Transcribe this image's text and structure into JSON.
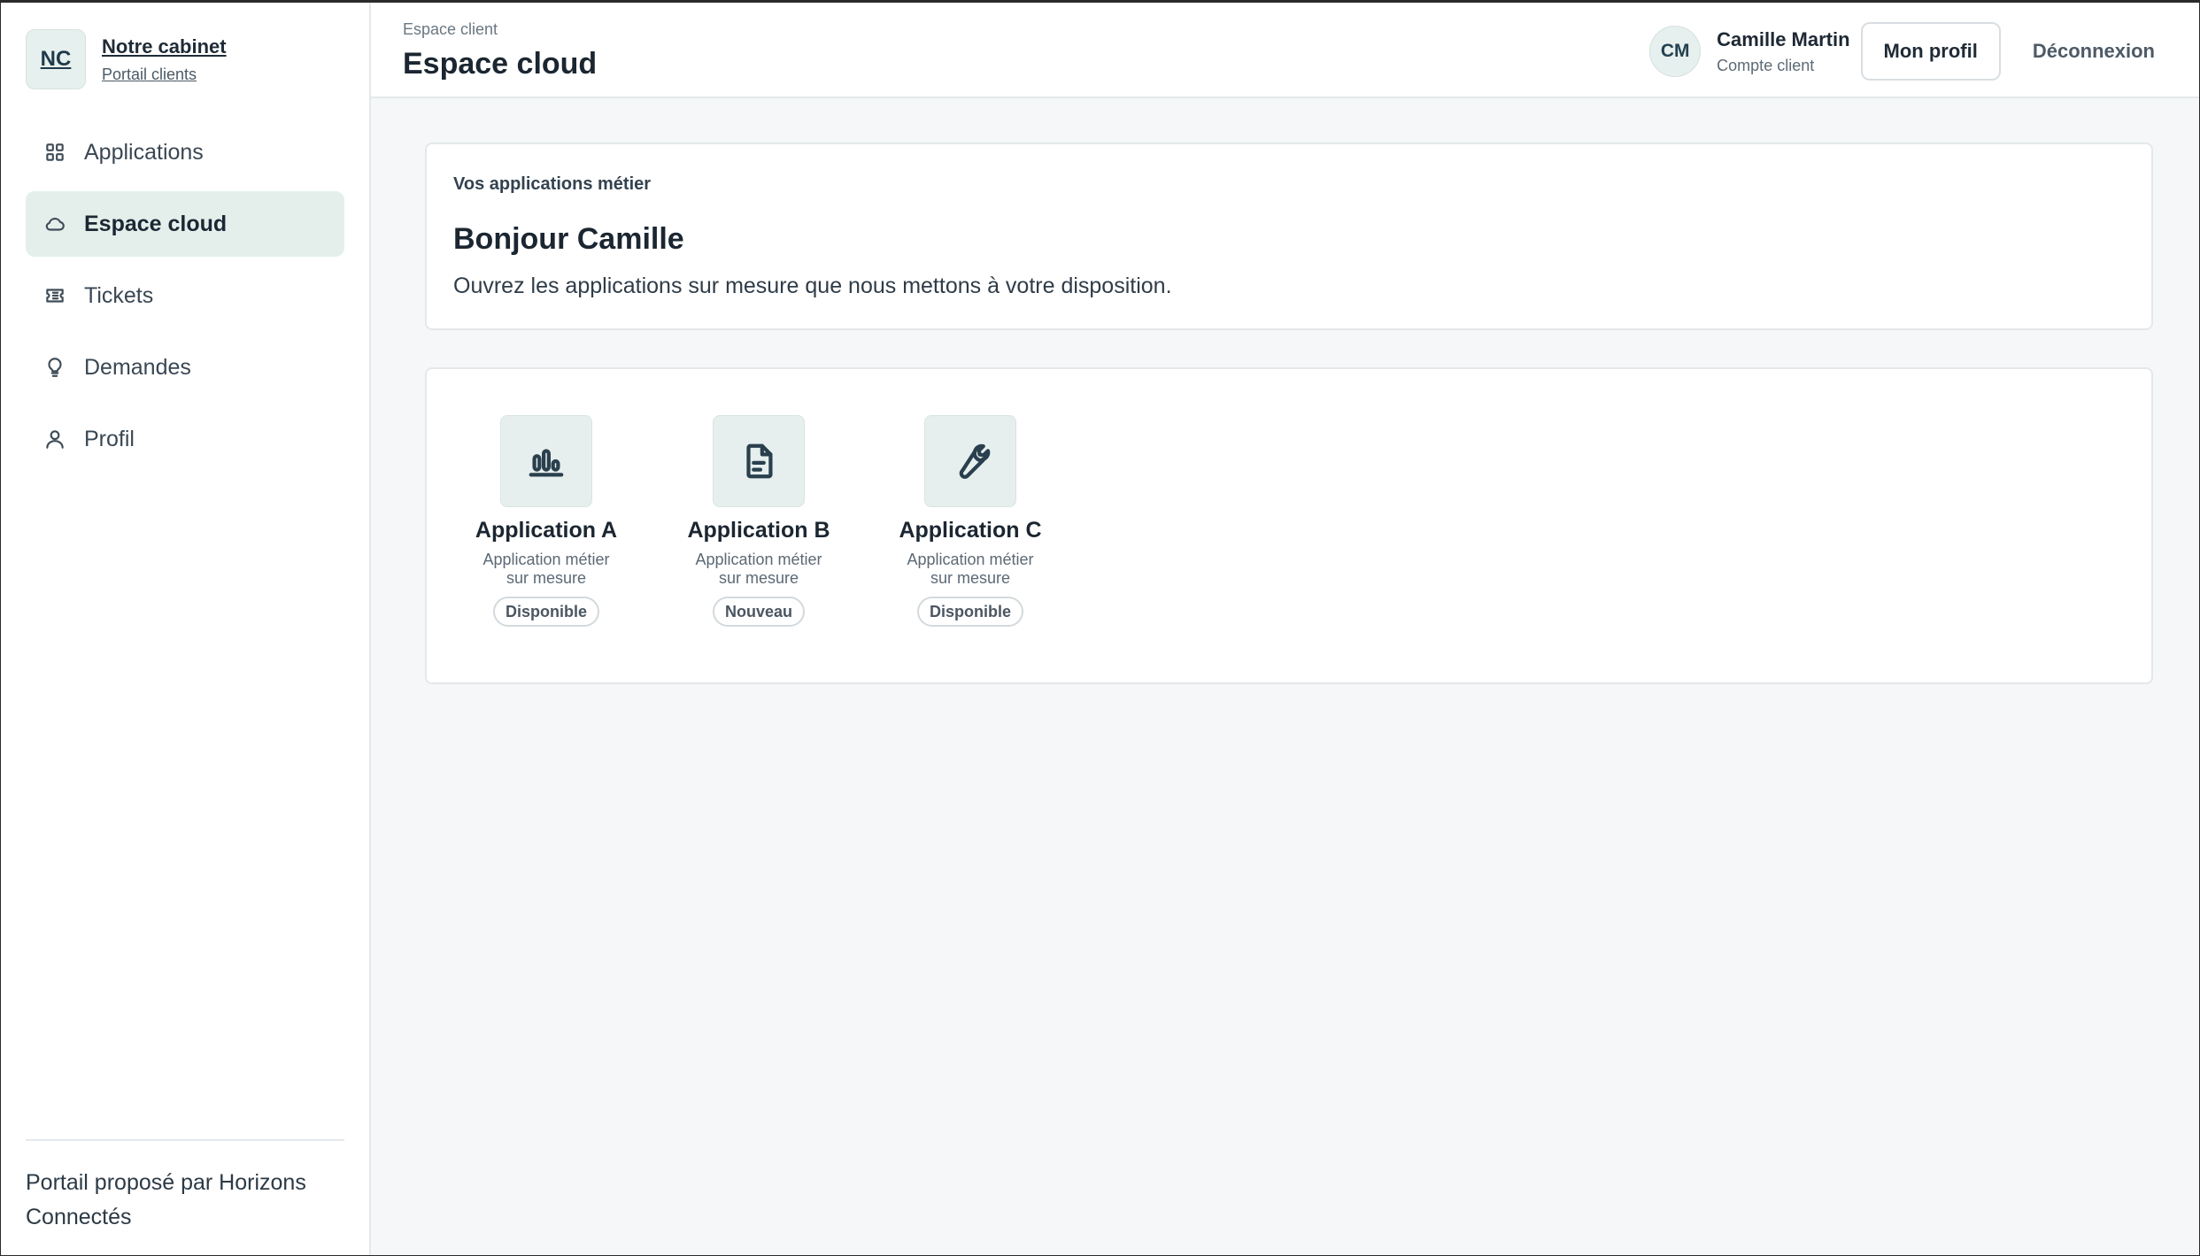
{
  "brand": {
    "initials": "NC",
    "name": "Notre cabinet",
    "subtitle": "Portail clients"
  },
  "sidebar": {
    "items": [
      {
        "label": "Applications",
        "icon": "grid-icon",
        "active": false
      },
      {
        "label": "Espace cloud",
        "icon": "cloud-icon",
        "active": true
      },
      {
        "label": "Tickets",
        "icon": "ticket-icon",
        "active": false
      },
      {
        "label": "Demandes",
        "icon": "lightbulb-icon",
        "active": false
      },
      {
        "label": "Profil",
        "icon": "user-icon",
        "active": false
      }
    ],
    "footer": "Portail proposé par Horizons Connectés"
  },
  "header": {
    "breadcrumb": "Espace client",
    "title": "Espace cloud",
    "user": {
      "initials": "CM",
      "name": "Camille Martin",
      "role": "Compte client"
    },
    "profile_button": "Mon profil",
    "logout_button": "Déconnexion"
  },
  "welcome": {
    "eyebrow": "Vos applications métier",
    "greeting": "Bonjour Camille",
    "description": "Ouvrez les applications sur mesure que nous mettons à votre disposition."
  },
  "apps": [
    {
      "name": "Application A",
      "desc_line1": "Application métier",
      "desc_line2": "sur mesure",
      "badge": "Disponible",
      "icon": "bar-chart-icon"
    },
    {
      "name": "Application B",
      "desc_line1": "Application métier",
      "desc_line2": "sur mesure",
      "badge": "Nouveau",
      "icon": "document-icon"
    },
    {
      "name": "Application C",
      "desc_line1": "Application métier",
      "desc_line2": "sur mesure",
      "badge": "Disponible",
      "icon": "wrench-icon"
    }
  ],
  "colors": {
    "accent_bg": "#e4efec",
    "text_primary": "#1b2631",
    "page_bg": "#f5f7f8"
  }
}
